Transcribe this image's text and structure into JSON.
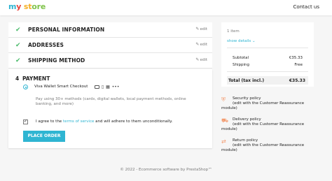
{
  "header": {
    "logo": {
      "part1": "m",
      "part2": "y",
      "part3": " st",
      "part4": "ore"
    },
    "contact_label": "Contact us"
  },
  "steps": [
    {
      "title": "PERSONAL INFORMATION",
      "edit_label": "edit"
    },
    {
      "title": "ADDRESSES",
      "edit_label": "edit"
    },
    {
      "title": "SHIPPING METHOD",
      "edit_label": "edit"
    }
  ],
  "payment": {
    "number": "4",
    "title": "PAYMENT",
    "method_label": "Viva Wallet Smart Checkout",
    "method_more": "•••",
    "description": "Pay using 30+ methods (cards, digital wallets, local payment methods, online banking, and more)",
    "terms_prefix": "I agree to the ",
    "terms_link": "terms of service",
    "terms_suffix": " and will adhere to them unconditionally.",
    "place_order_label": "PLACE ORDER"
  },
  "summary": {
    "items_count": "1 item",
    "show_details": "show details",
    "subtotal_label": "Subtotal",
    "subtotal_value": "€35.33",
    "shipping_label": "Shipping",
    "shipping_value": "Free",
    "total_label": "Total (tax incl.)",
    "total_value": "€35.33"
  },
  "reassurance": [
    {
      "title": "Security policy",
      "sub": "(edit with the Customer Reassurance",
      "sub2": "module)",
      "icon": "shield-icon"
    },
    {
      "title": "Delivery policy",
      "sub": "(edit with the Customer Reassurance",
      "sub2": "module)",
      "icon": "truck-icon"
    },
    {
      "title": "Return policy",
      "sub": "(edit with the Customer Reassurance",
      "sub2": "module)",
      "icon": "return-icon"
    }
  ],
  "footer": {
    "text": "© 2022 - Ecommerce software by PrestaShop™"
  },
  "colors": {
    "accent": "#2fb5d2",
    "check": "#4cbb6c",
    "reassure_icon": "#f39d72"
  }
}
